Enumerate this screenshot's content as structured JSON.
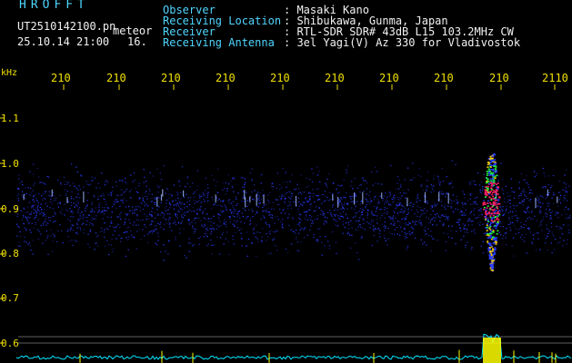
{
  "header": {
    "brand": "HROFFT",
    "file_name": "UT2510142100.pn",
    "meteor_label": "meteor",
    "date_time": "25.10.14 21:00",
    "count": "16.",
    "info": [
      {
        "label": "Observer",
        "value": ": Masaki Kano"
      },
      {
        "label": "Receiving Location",
        "value": ": Shibukawa, Gunma, Japan"
      },
      {
        "label": "Receiver",
        "value": ": RTL-SDR SDR# 43dB L15 103.2MHz CW"
      },
      {
        "label": "Receiving Antenna",
        "value": ": 3el Yagi(V) Az 330 for Vladivostok"
      }
    ]
  },
  "axes": {
    "y_unit": "kHz",
    "y_ticks": [
      "1.1",
      "1.0",
      "0.9",
      "0.8",
      "0.7",
      "0.6"
    ],
    "x_ticks": [
      "210",
      "210",
      "210",
      "210",
      "210",
      "210",
      "210",
      "210",
      "210",
      "2110"
    ]
  },
  "colors": {
    "background": "#000000",
    "label_text": "#4fd6ff",
    "value_text": "#f2f2f2",
    "tick_text": "#f0e000",
    "noise_blue": "#2a3cff",
    "echo_red": "#ff2060",
    "echo_green": "#22ff44",
    "level_trace": "#00e5ff",
    "level_peak": "#ffff00"
  }
}
